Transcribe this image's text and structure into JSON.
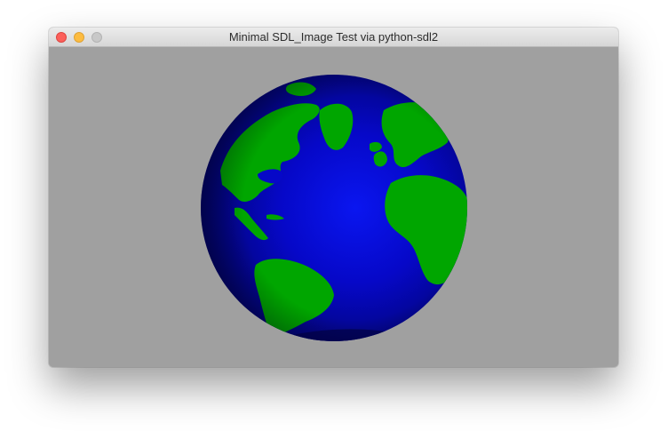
{
  "window": {
    "title": "Minimal SDL_Image Test via python-sdl2",
    "controls": {
      "close": "close-icon",
      "minimize": "minimize-icon",
      "maximize": "maximize-icon"
    }
  },
  "content": {
    "background_color": "#a0a0a0",
    "image": {
      "subject": "globe",
      "ocean_color": "#0000cc",
      "land_color": "#00a800"
    }
  }
}
